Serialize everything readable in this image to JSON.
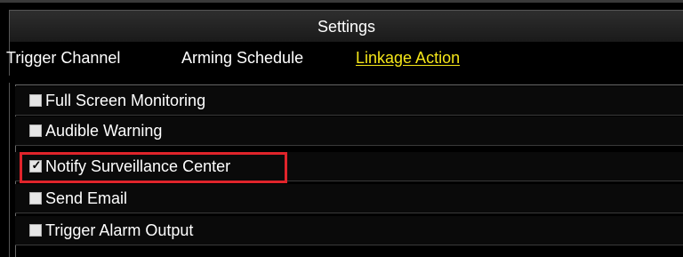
{
  "window": {
    "title": "Settings"
  },
  "tabs": [
    {
      "label": "Trigger Channel",
      "active": false
    },
    {
      "label": "Arming Schedule",
      "active": false
    },
    {
      "label": "Linkage Action",
      "active": true
    }
  ],
  "linkage_actions": [
    {
      "label": "Full Screen Monitoring",
      "checked": false
    },
    {
      "label": "Audible Warning",
      "checked": false
    },
    {
      "label": "Notify Surveillance Center",
      "checked": true
    },
    {
      "label": "Send Email",
      "checked": false
    },
    {
      "label": "Trigger Alarm Output",
      "checked": false
    }
  ],
  "colors": {
    "active_tab": "#f5e619",
    "highlight_box": "#e0242b",
    "background": "#000000"
  },
  "icons": {
    "checked": "checkmark-icon"
  }
}
